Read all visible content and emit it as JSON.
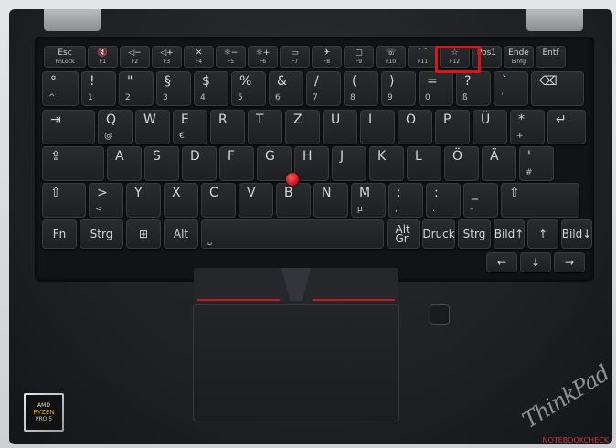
{
  "keyboard": {
    "highlight_color": "#e01418",
    "trackpoint_color": "#e02020",
    "rows": {
      "fn_row": [
        {
          "p": "Esc",
          "s": "FnLock"
        },
        {
          "p": "🔇",
          "s": "F1"
        },
        {
          "p": "◁−",
          "s": "F2"
        },
        {
          "p": "◁+",
          "s": "F3"
        },
        {
          "p": "✕",
          "s": "F4"
        },
        {
          "p": "☼−",
          "s": "F5"
        },
        {
          "p": "☼+",
          "s": "F6"
        },
        {
          "p": "▭",
          "s": "F7"
        },
        {
          "p": "✈",
          "s": "F8"
        },
        {
          "p": "▢",
          "s": "F9"
        },
        {
          "p": "☏",
          "s": "F10"
        },
        {
          "p": "⌒",
          "s": "F11"
        },
        {
          "p": "☆",
          "s": "F12"
        },
        {
          "p": "Pos1",
          "s": ""
        },
        {
          "p": "Ende",
          "s": "Einfg"
        },
        {
          "p": "Entf",
          "s": ""
        }
      ],
      "num_row": [
        {
          "p": "°",
          "s": "^"
        },
        {
          "p": "!",
          "s": "1"
        },
        {
          "p": "\"",
          "s": "2"
        },
        {
          "p": "§",
          "s": "3"
        },
        {
          "p": "$",
          "s": "4"
        },
        {
          "p": "%",
          "s": "5"
        },
        {
          "p": "&",
          "s": "6"
        },
        {
          "p": "/",
          "s": "7"
        },
        {
          "p": "(",
          "s": "8"
        },
        {
          "p": ")",
          "s": "9"
        },
        {
          "p": "=",
          "s": "0"
        },
        {
          "p": "?",
          "s": "ß"
        },
        {
          "p": "`",
          "s": "´"
        },
        {
          "p": "⌫",
          "s": ""
        }
      ],
      "q_row": [
        {
          "p": "⇥",
          "s": ""
        },
        {
          "p": "Q",
          "s": "@"
        },
        {
          "p": "W",
          "s": ""
        },
        {
          "p": "E",
          "s": "€"
        },
        {
          "p": "R",
          "s": ""
        },
        {
          "p": "T",
          "s": ""
        },
        {
          "p": "Z",
          "s": ""
        },
        {
          "p": "U",
          "s": ""
        },
        {
          "p": "I",
          "s": ""
        },
        {
          "p": "O",
          "s": ""
        },
        {
          "p": "P",
          "s": ""
        },
        {
          "p": "Ü",
          "s": ""
        },
        {
          "p": "*",
          "s": "+"
        },
        {
          "p": "↵",
          "s": ""
        }
      ],
      "a_row": [
        {
          "p": "⇪",
          "s": ""
        },
        {
          "p": "A",
          "s": ""
        },
        {
          "p": "S",
          "s": ""
        },
        {
          "p": "D",
          "s": ""
        },
        {
          "p": "F",
          "s": ""
        },
        {
          "p": "G",
          "s": ""
        },
        {
          "p": "H",
          "s": ""
        },
        {
          "p": "J",
          "s": ""
        },
        {
          "p": "K",
          "s": ""
        },
        {
          "p": "L",
          "s": ""
        },
        {
          "p": "Ö",
          "s": ""
        },
        {
          "p": "Ä",
          "s": ""
        },
        {
          "p": "'",
          "s": "#"
        }
      ],
      "z_row": [
        {
          "p": "⇧",
          "s": ""
        },
        {
          "p": ">",
          "s": "<"
        },
        {
          "p": "Y",
          "s": ""
        },
        {
          "p": "X",
          "s": ""
        },
        {
          "p": "C",
          "s": ""
        },
        {
          "p": "V",
          "s": ""
        },
        {
          "p": "B",
          "s": ""
        },
        {
          "p": "N",
          "s": ""
        },
        {
          "p": "M",
          "s": "µ"
        },
        {
          "p": ";",
          "s": ","
        },
        {
          "p": ":",
          "s": "."
        },
        {
          "p": "_",
          "s": "-"
        },
        {
          "p": "⇧",
          "s": ""
        }
      ],
      "bottom_row": [
        {
          "p": "Fn",
          "s": ""
        },
        {
          "p": "Strg",
          "s": ""
        },
        {
          "p": "⊞",
          "s": ""
        },
        {
          "p": "Alt",
          "s": ""
        },
        {
          "p": "",
          "s": "␣"
        },
        {
          "p": "Alt Gr",
          "s": ""
        },
        {
          "p": "Druck",
          "s": ""
        },
        {
          "p": "Strg",
          "s": ""
        },
        {
          "p": "Bild↑",
          "s": ""
        },
        {
          "p": "↑",
          "s": ""
        },
        {
          "p": "Bild↓",
          "s": ""
        }
      ],
      "arrow_row": [
        {
          "p": "←",
          "s": ""
        },
        {
          "p": "↓",
          "s": ""
        },
        {
          "p": "→",
          "s": ""
        }
      ]
    }
  },
  "branding": {
    "laptop_logo": "ThinkPad",
    "cpu_badge_top": "AMD",
    "cpu_badge_main": "RYZEN",
    "cpu_badge_sub": "PRO 5",
    "watermark": "NOTEBOOKCHECK"
  }
}
